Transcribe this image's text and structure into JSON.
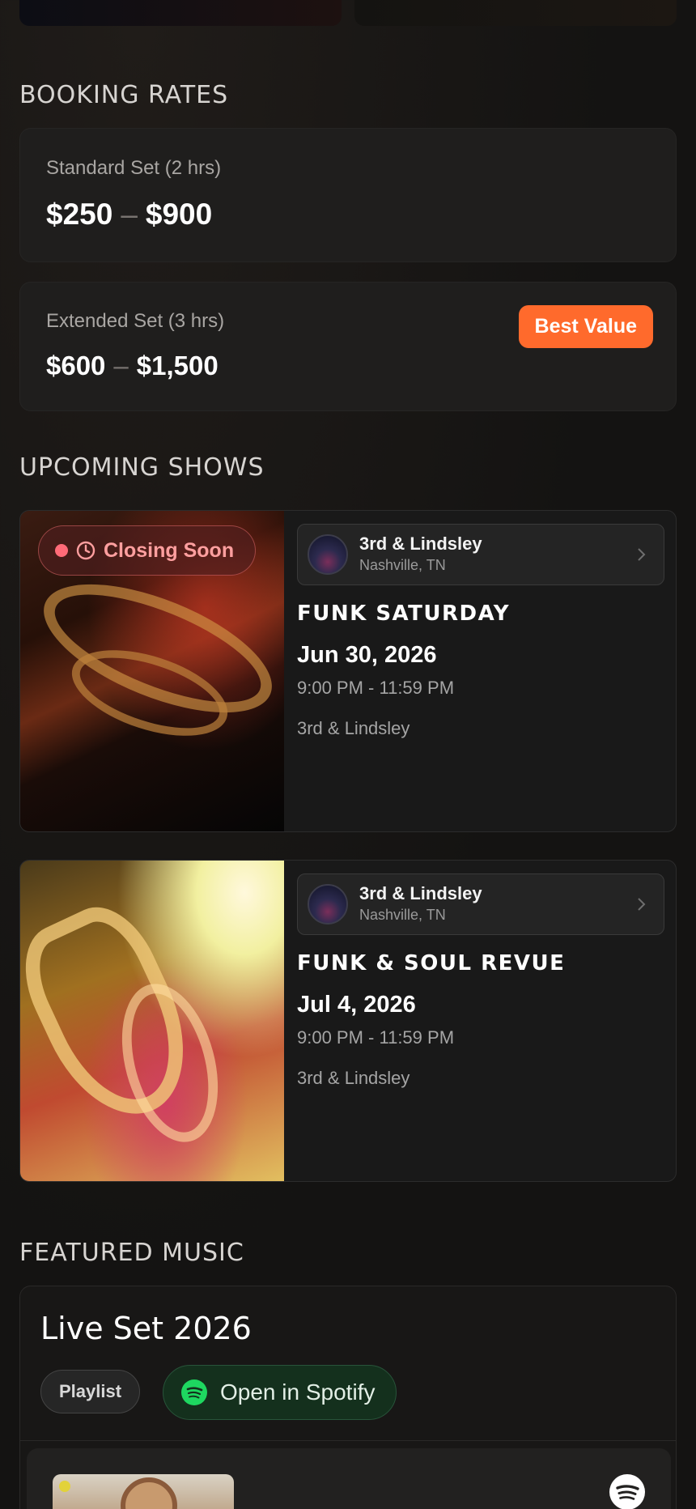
{
  "booking": {
    "title": "BOOKING RATES",
    "standard": {
      "label": "Standard Set (2 hrs)",
      "min": "$250",
      "sep": "–",
      "max": "$900"
    },
    "extended": {
      "label": "Extended Set (3 hrs)",
      "min": "$600",
      "sep": "–",
      "max": "$1,500",
      "badge": "Best Value"
    }
  },
  "shows": {
    "title": "UPCOMING SHOWS",
    "items": [
      {
        "badge": "Closing Soon",
        "venue_name": "3rd & Lindsley",
        "venue_city": "Nashville, TN",
        "title": "FUNK SATURDAY",
        "date": "Jun 30, 2026",
        "time": "9:00 PM - 11:59 PM",
        "venue": "3rd & Lindsley"
      },
      {
        "venue_name": "3rd & Lindsley",
        "venue_city": "Nashville, TN",
        "title": "FUNK & SOUL REVUE",
        "date": "Jul 4, 2026",
        "time": "9:00 PM - 11:59 PM",
        "venue": "3rd & Lindsley"
      }
    ]
  },
  "music": {
    "title": "FEATURED MUSIC",
    "card_title": "Live Set 2026",
    "playlist_label": "Playlist",
    "spotify_label": "Open in Spotify"
  },
  "colors": {
    "accent": "#ff6a2c",
    "closing": "#ff9f9f",
    "spotify": "#1ed760",
    "background": "#161413"
  }
}
